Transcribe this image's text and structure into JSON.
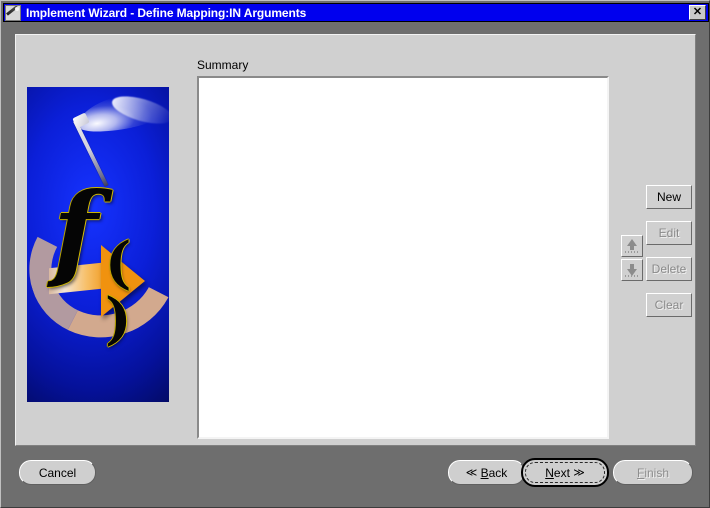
{
  "window": {
    "title": "Implement Wizard - Define Mapping:IN Arguments",
    "icon": "wand-icon",
    "close_label": "✕",
    "frame_color": "#6e6e6e",
    "titlebar_color": "#0000ee",
    "panel_color": "#d0d0d0"
  },
  "banner": {
    "name": "function-wizard-graphic",
    "symbol": "f",
    "parens": "( )",
    "background_color": "#0000dd",
    "arrow_color": "#f0920f"
  },
  "main": {
    "summary_label": "Summary",
    "summary_items": []
  },
  "side_buttons": [
    {
      "name": "new-button",
      "label": "New",
      "enabled": true
    },
    {
      "name": "edit-button",
      "label": "Edit",
      "enabled": false
    },
    {
      "name": "delete-button",
      "label": "Delete",
      "enabled": false
    },
    {
      "name": "clear-button",
      "label": "Clear",
      "enabled": false
    }
  ],
  "move_buttons": [
    {
      "name": "move-up-button",
      "icon": "arrow-up-icon",
      "enabled": false
    },
    {
      "name": "move-down-button",
      "icon": "arrow-down-icon",
      "enabled": false
    }
  ],
  "footer": {
    "cancel": {
      "label": "Cancel",
      "enabled": true
    },
    "back": {
      "chevron": "≪",
      "mnemonic": "B",
      "rest": "ack",
      "enabled": true
    },
    "next": {
      "mnemonic": "N",
      "rest": "ext",
      "chevron": "≫",
      "enabled": true,
      "is_default": true
    },
    "finish": {
      "mnemonic": "F",
      "rest": "inish",
      "enabled": false
    }
  }
}
